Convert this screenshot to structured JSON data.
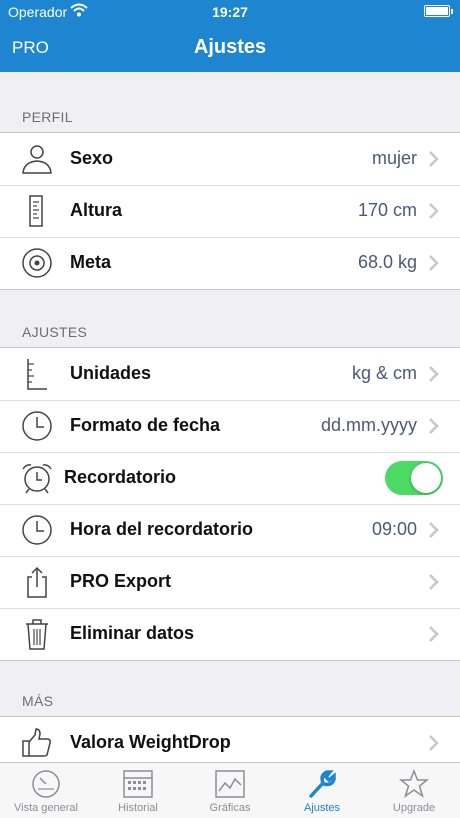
{
  "status_bar": {
    "carrier": "Operador",
    "time": "19:27"
  },
  "nav": {
    "left_button": "PRO",
    "title": "Ajustes"
  },
  "sections": [
    {
      "header": "PERFIL",
      "rows": [
        {
          "label": "Sexo",
          "value": "mujer",
          "icon": "person-icon"
        },
        {
          "label": "Altura",
          "value": "170 cm",
          "icon": "height-ruler-icon"
        },
        {
          "label": "Meta",
          "value": "68.0 kg",
          "icon": "target-icon"
        }
      ]
    },
    {
      "header": "AJUSTES",
      "rows": [
        {
          "label": "Unidades",
          "value": "kg & cm",
          "icon": "ruler-icon"
        },
        {
          "label": "Formato de fecha",
          "value": "dd.mm.yyyy",
          "icon": "clock-icon"
        },
        {
          "label": "Recordatorio",
          "value": "",
          "icon": "alarm-clock-icon",
          "toggle_on": true
        },
        {
          "label": "Hora del recordatorio",
          "value": "09:00",
          "icon": "clock-icon"
        },
        {
          "label": "PRO Export",
          "value": "",
          "icon": "share-icon"
        },
        {
          "label": "Eliminar datos",
          "value": "",
          "icon": "trash-icon"
        }
      ]
    },
    {
      "header": "MÁS",
      "rows": [
        {
          "label": "Valora WeightDrop",
          "value": "",
          "icon": "thumbs-up-icon"
        }
      ]
    }
  ],
  "tabs": [
    {
      "label": "Vista general",
      "icon": "gauge-icon",
      "active": false
    },
    {
      "label": "Historial",
      "icon": "calendar-icon",
      "active": false
    },
    {
      "label": "Gráficas",
      "icon": "chart-icon",
      "active": false
    },
    {
      "label": "Ajustes",
      "icon": "wrench-icon",
      "active": true
    },
    {
      "label": "Upgrade",
      "icon": "star-icon",
      "active": false
    }
  ],
  "colors": {
    "accent": "#1e86d1",
    "toggle_on": "#4cd964",
    "value_text": "#4a5a78"
  }
}
